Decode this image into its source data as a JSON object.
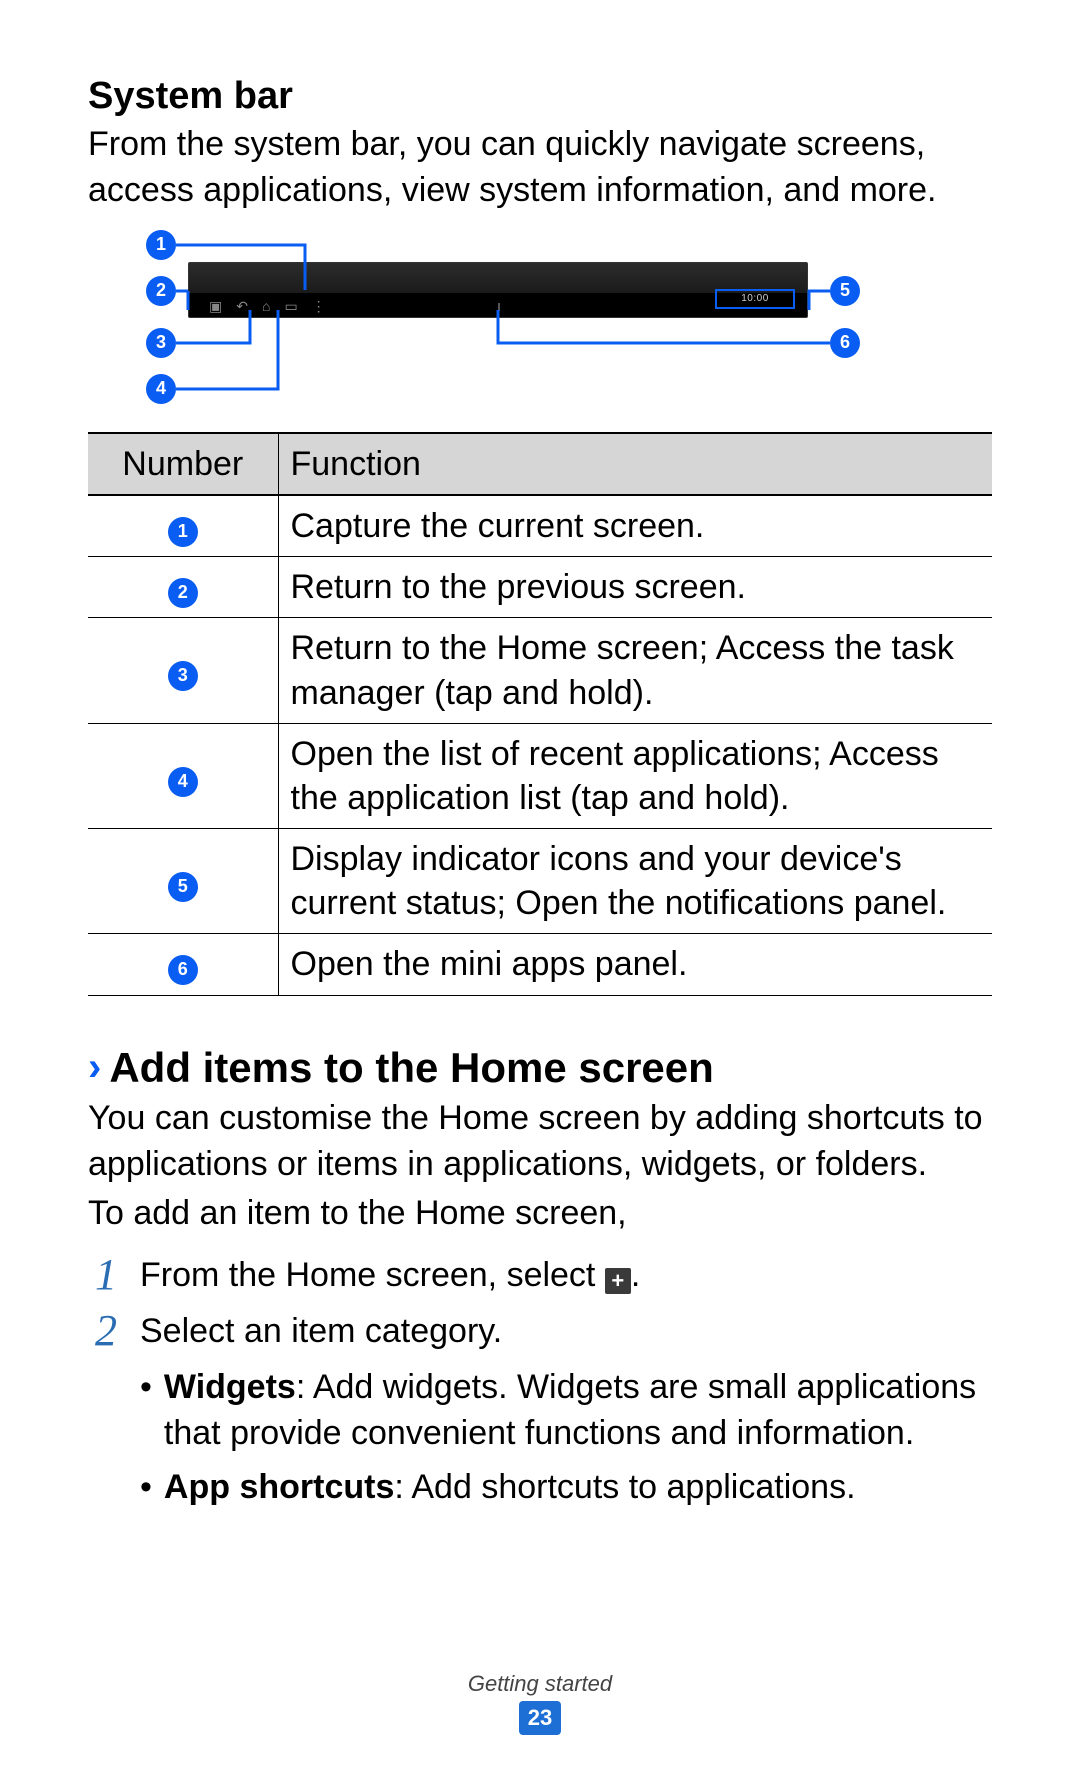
{
  "section": {
    "title": "System bar",
    "desc": "From the system bar, you can quickly navigate screens, access applications, view system information, and more."
  },
  "diagram": {
    "status_text": "10:00",
    "numbers": [
      "1",
      "2",
      "3",
      "4",
      "5",
      "6"
    ]
  },
  "table": {
    "header_number": "Number",
    "header_function": "Function",
    "rows": [
      {
        "n": "1",
        "fn": "Capture the current screen."
      },
      {
        "n": "2",
        "fn": "Return to the previous screen."
      },
      {
        "n": "3",
        "fn": "Return to the Home screen; Access the task manager (tap and hold)."
      },
      {
        "n": "4",
        "fn": "Open the list of recent applications; Access the application list (tap and hold)."
      },
      {
        "n": "5",
        "fn": "Display indicator icons and your device's current status; Open the notifications panel."
      },
      {
        "n": "6",
        "fn": "Open the mini apps panel."
      }
    ]
  },
  "subsection": {
    "chevron": "›",
    "title": "Add items to the Home screen",
    "desc": "You can customise the Home screen by adding shortcuts to applications or items in applications, widgets, or folders.",
    "intro": "To add an item to the Home screen,",
    "steps": [
      {
        "num": "1",
        "text_before": "From the Home screen, select ",
        "icon": "plus",
        "text_after": "."
      },
      {
        "num": "2",
        "text_before": "Select an item category.",
        "icon": null,
        "text_after": ""
      }
    ],
    "bullets": [
      {
        "bold": "Widgets",
        "rest": ": Add widgets. Widgets are small applications that provide convenient functions and information."
      },
      {
        "bold": "App shortcuts",
        "rest": ": Add shortcuts to applications."
      }
    ]
  },
  "footer": {
    "section_name": "Getting started",
    "page_number": "23"
  }
}
